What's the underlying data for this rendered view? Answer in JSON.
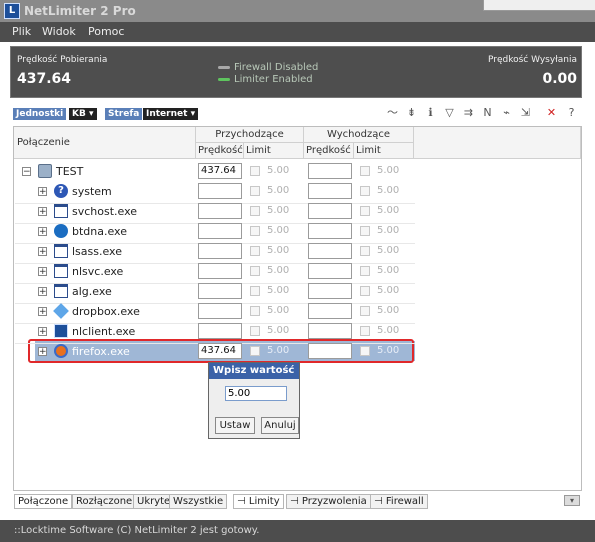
{
  "window": {
    "title": "NetLimiter 2 Pro",
    "logo_letter": "L"
  },
  "menu": {
    "items": [
      "Plik",
      "Widok",
      "Pomoc"
    ]
  },
  "speed": {
    "download_label": "Prędkość Pobierania",
    "download_value": "437.64",
    "upload_label": "Prędkość Wysyłania",
    "upload_value": "0.00",
    "firewall_status": "Firewall Disabled",
    "limiter_status": "Limiter Enabled"
  },
  "toolbar": {
    "units_label": "Jednostki",
    "units_value": "KB",
    "zone_label": "Strefa",
    "zone_value": "Internet"
  },
  "grid": {
    "col_connection": "Połączenie",
    "col_incoming": "Przychodzące",
    "col_outgoing": "Wychodzące",
    "col_speed": "Prędkość",
    "col_limit": "Limit",
    "root": {
      "name": "TEST",
      "in_speed": "437.64",
      "in_limit": "5.00",
      "out_speed": "",
      "out_limit": "5.00"
    },
    "rows": [
      {
        "name": "system",
        "icon": "system-icon",
        "in_speed": "",
        "in_limit": "5.00",
        "out_speed": "",
        "out_limit": "5.00"
      },
      {
        "name": "svchost.exe",
        "icon": "window-app-icon",
        "in_speed": "",
        "in_limit": "5.00",
        "out_speed": "",
        "out_limit": "5.00"
      },
      {
        "name": "btdna.exe",
        "icon": "btdna-icon",
        "in_speed": "",
        "in_limit": "5.00",
        "out_speed": "",
        "out_limit": "5.00"
      },
      {
        "name": "lsass.exe",
        "icon": "window-app-icon",
        "in_speed": "",
        "in_limit": "5.00",
        "out_speed": "",
        "out_limit": "5.00"
      },
      {
        "name": "nlsvc.exe",
        "icon": "window-app-icon",
        "in_speed": "",
        "in_limit": "5.00",
        "out_speed": "",
        "out_limit": "5.00"
      },
      {
        "name": "alg.exe",
        "icon": "window-app-icon",
        "in_speed": "",
        "in_limit": "5.00",
        "out_speed": "",
        "out_limit": "5.00"
      },
      {
        "name": "dropbox.exe",
        "icon": "dropbox-icon",
        "in_speed": "",
        "in_limit": "5.00",
        "out_speed": "",
        "out_limit": "5.00"
      },
      {
        "name": "nlclient.exe",
        "icon": "netlimiter-icon",
        "in_speed": "",
        "in_limit": "5.00",
        "out_speed": "",
        "out_limit": "5.00"
      },
      {
        "name": "firefox.exe",
        "icon": "firefox-icon",
        "in_speed": "437.64",
        "in_limit": "5.00",
        "out_speed": "",
        "out_limit": "5.00",
        "selected": true
      }
    ]
  },
  "popup": {
    "title": "Wpisz wartość",
    "value": "5.00",
    "ok_label": "Ustaw",
    "cancel_label": "Anuluj"
  },
  "bottom_tabs": {
    "left": [
      "Połączone",
      "Rozłączone",
      "Ukryte",
      "Wszystkie"
    ],
    "right": [
      "Limity",
      "Przyzwolenia",
      "Firewall"
    ]
  },
  "status": {
    "text": "::Locktime Software (C) NetLimiter 2 jest gotowy."
  },
  "colors": {
    "accent": "#3b62a8",
    "selection": "#9fb7d6",
    "highlight": "#e0282a",
    "panel": "#4e4e4e"
  }
}
